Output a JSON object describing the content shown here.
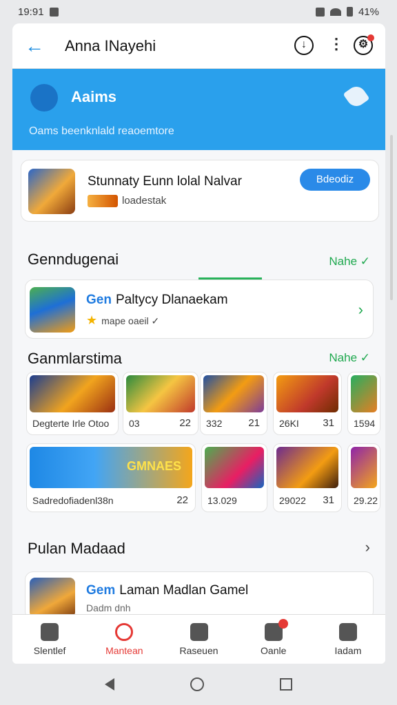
{
  "status": {
    "time": "19:91",
    "battery": "41%"
  },
  "appbar": {
    "title": "Anna INayehi"
  },
  "banner": {
    "title": "Aaims",
    "subtitle": "Oams beenknlald reaoemtore"
  },
  "featured": {
    "title": "Stunnaty Eunn lolal Nalvar",
    "subtitle": "loadestak",
    "button": "Bdeodiz"
  },
  "section1": {
    "title": "Genndugenai",
    "more": "Nahe ✓"
  },
  "item1": {
    "tag": "Gen",
    "title": "Paltycy Dlanaekam",
    "subtitle": "mape oaeil ✓"
  },
  "section2": {
    "title": "Ganmlarstima",
    "more": "Nahe ✓"
  },
  "tiles_row1": [
    {
      "caption": "Degterte Irle Otoo",
      "num": "",
      "color": "linear-gradient(135deg,#1c3d8f,#f1a41e 55%,#9a2f12)"
    },
    {
      "caption": "03",
      "num": "22",
      "color": "linear-gradient(135deg,#2b8a3e,#f5c542 50%,#c0392b)"
    },
    {
      "caption": "332",
      "num": "21",
      "color": "linear-gradient(135deg,#1f4fa3,#f39c12 50%,#7d3c98)"
    },
    {
      "caption": "26KI",
      "num": "31",
      "color": "linear-gradient(135deg,#f39c12,#c0392b 60%,#6e2c00)"
    },
    {
      "caption": "1594",
      "num": "",
      "color": "linear-gradient(135deg,#27ae60,#e67e22)"
    }
  ],
  "tiles_row2": [
    {
      "caption": "Sadredofiadenl38n",
      "num": "22",
      "overlay": "GMNAES",
      "color": "linear-gradient(90deg,#1e88e5,#42a5f5 40%,#f4a61b)"
    },
    {
      "caption": "13.029",
      "num": "",
      "color": "linear-gradient(135deg,#4caf50,#e91e63 60%,#1565c0)"
    },
    {
      "caption": "29022",
      "num": "31",
      "color": "linear-gradient(135deg,#6d2b8f,#f39c12 60%,#3e1f0e)"
    },
    {
      "caption": "29.22",
      "num": "",
      "color": "linear-gradient(135deg,#8e24aa,#f4a61b)"
    }
  ],
  "section3": {
    "title": "Pulan Madaad"
  },
  "detail": {
    "tag": "Gem",
    "title": "Laman Madlan Gamel",
    "subtitle": "Dadm dnh"
  },
  "nav": [
    {
      "label": "Slentlef",
      "icon": "home-icon"
    },
    {
      "label": "Mantean",
      "icon": "games-icon"
    },
    {
      "label": "Raseuen",
      "icon": "store-icon"
    },
    {
      "label": "Oanle",
      "icon": "controller-icon"
    },
    {
      "label": "Iadam",
      "icon": "profile-icon"
    }
  ]
}
